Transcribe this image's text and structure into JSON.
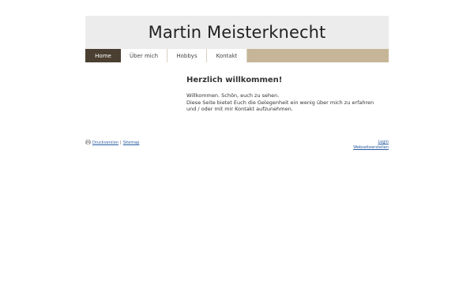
{
  "header": {
    "title": "Martin Meisterknecht"
  },
  "nav": {
    "items": [
      {
        "label": "Home"
      },
      {
        "label": "Über mich"
      },
      {
        "label": "Hobbys"
      },
      {
        "label": "Kontakt"
      }
    ],
    "active_index": 0
  },
  "content": {
    "heading": "Herzlich willkommen!",
    "para1": "Willkommen. Schön, euch zu sehen.",
    "para2": "Diese Seite bietet Euch die Gelegenheit ein wenig über mich zu erfahren und / oder mit mir Kontakt aufzunehmen."
  },
  "footer": {
    "print_link": "Druckversion",
    "separator": "|",
    "sitemap_link": "Sitemap",
    "login_link": "Login",
    "builder_link": "Webseiteerstellen"
  },
  "colors": {
    "nav_active_bg": "#4a3f30",
    "nav_bar_bg": "#c6b697",
    "header_bg": "#ececec",
    "link": "#2a5d9f"
  }
}
